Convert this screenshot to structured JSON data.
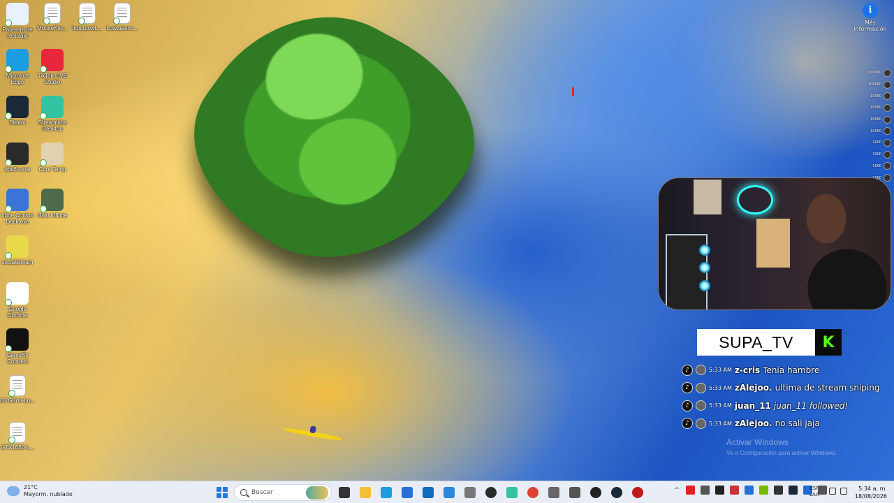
{
  "desktop": {
    "icons": [
      {
        "label": "Papelera de reciclaje",
        "icon": "recycle-bin-icon",
        "color": "#e8f2ff"
      },
      {
        "label": "MouseKey...",
        "icon": "document-icon",
        "color": "#ffffff"
      },
      {
        "label": "InputLowL...",
        "icon": "document-icon",
        "color": "#ffffff"
      },
      {
        "label": "LowLatenc...",
        "icon": "document-icon",
        "color": "#ffffff"
      },
      {
        "label": "Microsoft Edge",
        "icon": "edge-icon",
        "color": "#1b9de2"
      },
      {
        "label": "TikTok LIVE Studio",
        "icon": "tiktok-live-icon",
        "color": "#e8273d"
      },
      {
        "label": "Steam",
        "icon": "steam-icon",
        "color": "#1b2838"
      },
      {
        "label": "Streamlabs Desktop",
        "icon": "streamlabs-icon",
        "color": "#31c3a2"
      },
      {
        "label": "obs64.exe",
        "icon": "obs-icon",
        "color": "#2a2a2a"
      },
      {
        "label": "Core Temp",
        "icon": "thermometer-icon",
        "color": "#e0d2b0"
      },
      {
        "label": "Ifrine Control Deck.exe",
        "icon": "control-deck-icon",
        "color": "#3a74d8"
      },
      {
        "label": "Halo Infinite",
        "icon": "halo-icon",
        "color": "#4d6b4a"
      },
      {
        "label": "socialstream",
        "icon": "socialstream-icon",
        "color": "#e8d84a"
      },
      {
        "label": "Google Chrome",
        "icon": "chrome-icon",
        "color": "#ffffff"
      },
      {
        "label": "GameSir Connect",
        "icon": "gamesir-icon",
        "color": "#111111"
      },
      {
        "label": "DXGKrnl-Lo...",
        "icon": "document-icon",
        "color": "#ffffff"
      },
      {
        "label": "GTX1660-L...",
        "icon": "document-icon",
        "color": "#ffffff"
      }
    ]
  },
  "info_widget": {
    "label": "Más información",
    "icon": "info-icon"
  },
  "viewers": [
    "100000",
    "100000",
    "10000",
    "10000",
    "10000",
    "10000",
    "1000",
    "1000",
    "1000",
    "1000"
  ],
  "streamer": {
    "name": "SUPA_TV",
    "platform_icon": "kick-icon",
    "accent": "#53fc18"
  },
  "chat": [
    {
      "time": "5:33 AM",
      "user": "z-cris",
      "message": "Tenía hambre",
      "follow": false
    },
    {
      "time": "5:33 AM",
      "user": "zAlejoo.",
      "message": "ultima de stream sniping",
      "follow": false
    },
    {
      "time": "5:33 AM",
      "user": "juan_11",
      "message": "juan_11 followed!",
      "follow": true
    },
    {
      "time": "5:33 AM",
      "user": "zAlejoo.",
      "message": "no sali jaja",
      "follow": false
    }
  ],
  "watermark": {
    "title": "Activar Windows",
    "subtitle": "Ve a Configuración para activar Windows."
  },
  "taskbar": {
    "weather_temp": "21°C",
    "weather_desc": "Mayorm. nublado",
    "search_placeholder": "Buscar",
    "apps": [
      {
        "name": "taskview-icon",
        "color": "#333333"
      },
      {
        "name": "file-explorer-icon",
        "color": "#f2c037"
      },
      {
        "name": "edge-icon",
        "color": "#1b9de2"
      },
      {
        "name": "store-icon",
        "color": "#2670d9"
      },
      {
        "name": "outlook-icon",
        "color": "#0f6cbd"
      },
      {
        "name": "photos-icon",
        "color": "#2b88d8"
      },
      {
        "name": "disk-icon",
        "color": "#777777"
      },
      {
        "name": "obs-icon",
        "color": "#2a2a2a"
      },
      {
        "name": "streamlabs-icon",
        "color": "#31c3a2"
      },
      {
        "name": "chrome-icon",
        "color": "#de4032"
      },
      {
        "name": "settings-icon",
        "color": "#666666"
      },
      {
        "name": "gear-icon",
        "color": "#555555"
      },
      {
        "name": "mouse-icon",
        "color": "#222222"
      },
      {
        "name": "steam-icon",
        "color": "#1b2838"
      },
      {
        "name": "gamesir-icon",
        "color": "#c11a1a"
      }
    ],
    "tray_icons": [
      {
        "name": "pdf-icon",
        "color": "#d22"
      },
      {
        "name": "network-app-icon",
        "color": "#555"
      },
      {
        "name": "obs-tray-icon",
        "color": "#222"
      },
      {
        "name": "app-tray-icon",
        "color": "#c33"
      },
      {
        "name": "display-icon",
        "color": "#2670d9"
      },
      {
        "name": "nvidia-icon",
        "color": "#76b900"
      },
      {
        "name": "defender-icon",
        "color": "#333"
      },
      {
        "name": "steam-tray-icon",
        "color": "#1b2838"
      },
      {
        "name": "bluetooth-icon",
        "color": "#1f6bd8"
      },
      {
        "name": "usb-icon",
        "color": "#555"
      }
    ],
    "lang_top": "ESP",
    "lang_bottom": "LAA",
    "time": "5:34 a. m.",
    "date": "18/08/2026"
  }
}
